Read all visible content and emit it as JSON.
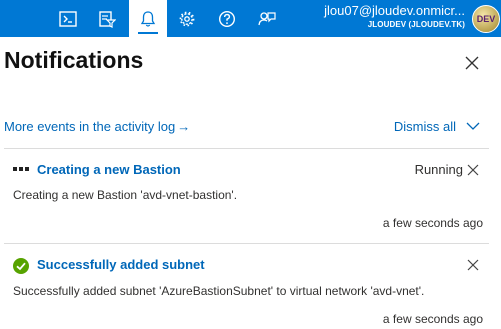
{
  "topbar": {
    "icons": [
      "cloud-shell-icon",
      "directory-filter-icon",
      "bell-icon",
      "gear-icon",
      "help-icon",
      "feedback-icon"
    ],
    "account": {
      "email": "jlou07@jloudev.onmicr...",
      "tenant": "JLOUDEV (JLOUDEV.TK)",
      "avatar_text": "DEV"
    }
  },
  "panel": {
    "title": "Notifications",
    "activity_link": "More events in the activity log",
    "activity_arrow": "→",
    "dismiss_all": "Dismiss all"
  },
  "notifications": [
    {
      "title": "Creating a new Bastion",
      "status": "Running",
      "body": "Creating a new Bastion 'avd-vnet-bastion'.",
      "time": "a few seconds ago",
      "icon": "in-progress-dots-icon"
    },
    {
      "title": "Successfully added subnet",
      "status": "",
      "body": "Successfully added subnet 'AzureBastionSubnet' to virtual network 'avd-vnet'.",
      "time": "a few seconds ago",
      "icon": "success-check-icon"
    }
  ],
  "colors": {
    "topbar": "#0078d4",
    "link": "#0067b8",
    "success": "#57a300"
  }
}
